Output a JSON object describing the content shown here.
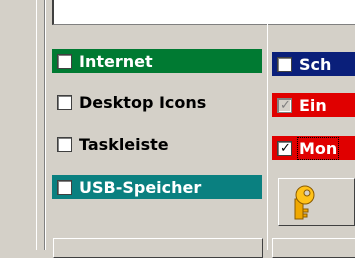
{
  "left_column": {
    "items": [
      {
        "label": "Internet",
        "checked": false,
        "bg": "#007a32",
        "fg": "#ffffff"
      },
      {
        "label": "Desktop Icons",
        "checked": false,
        "bg": "transparent",
        "fg": "#000000"
      },
      {
        "label": "Taskleiste",
        "checked": false,
        "bg": "transparent",
        "fg": "#000000"
      },
      {
        "label": "USB-Speicher",
        "checked": false,
        "bg": "#0a8080",
        "fg": "#ffffff"
      }
    ]
  },
  "right_column": {
    "items": [
      {
        "label": "Sch",
        "checked": false,
        "disabled": false,
        "bg": "#0a1f7a",
        "fg": "#ffffff"
      },
      {
        "label": "Ein",
        "checked": true,
        "disabled": true,
        "bg": "#e00000",
        "fg": "#ffffff"
      },
      {
        "label": "Mon",
        "checked": true,
        "disabled": false,
        "bg": "#e00000",
        "fg": "#ffffff"
      }
    ]
  },
  "icons": {
    "key": "key-icon",
    "key_color": "#f0a800"
  },
  "marks": {
    "check": "✓"
  }
}
